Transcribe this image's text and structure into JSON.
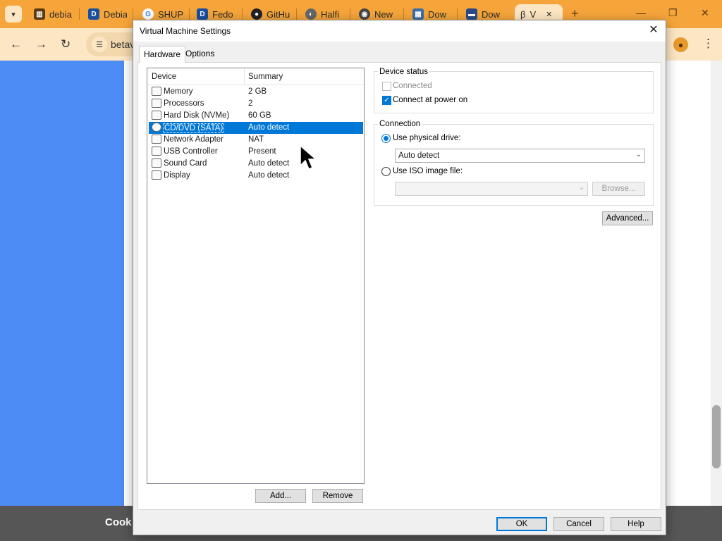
{
  "browser": {
    "tabs": [
      {
        "label": "debia",
        "icon": "library-icon",
        "color": "#5a3a10"
      },
      {
        "label": "Debia",
        "icon": "d-logo-icon",
        "color": "#1a4fa0"
      },
      {
        "label": "SHUP",
        "icon": "google-icon",
        "color": "#4285f4"
      },
      {
        "label": "Fedo",
        "icon": "d-logo-icon",
        "color": "#1a4fa0"
      },
      {
        "label": "GitHu",
        "icon": "github-icon",
        "color": "#222222"
      },
      {
        "label": "Halfi",
        "icon": "globe-icon",
        "color": "#555555"
      },
      {
        "label": "New",
        "icon": "chrome-icon",
        "color": "#444444"
      },
      {
        "label": "Dow",
        "icon": "vmware-icon",
        "color": "#3a6ea5"
      },
      {
        "label": "Dow",
        "icon": "vmware-icon",
        "color": "#2a4b8a"
      },
      {
        "label": "V",
        "icon": "beta-icon",
        "color": "#333333"
      }
    ],
    "address_text": "betav",
    "cookie_text": "Cook"
  },
  "dialog": {
    "title": "Virtual Machine Settings",
    "close_glyph": "✕",
    "tabs": [
      "Hardware",
      "Options"
    ],
    "device_list": {
      "columns": [
        "Device",
        "Summary"
      ],
      "rows": [
        {
          "device": "Memory",
          "summary": "2 GB",
          "icon": "memory-icon"
        },
        {
          "device": "Processors",
          "summary": "2",
          "icon": "processor-icon"
        },
        {
          "device": "Hard Disk (NVMe)",
          "summary": "60 GB",
          "icon": "hard-disk-icon"
        },
        {
          "device": "CD/DVD (SATA)",
          "summary": "Auto detect",
          "icon": "cd-dvd-icon",
          "selected": true
        },
        {
          "device": "Network Adapter",
          "summary": "NAT",
          "icon": "network-adapter-icon"
        },
        {
          "device": "USB Controller",
          "summary": "Present",
          "icon": "usb-controller-icon"
        },
        {
          "device": "Sound Card",
          "summary": "Auto detect",
          "icon": "sound-card-icon"
        },
        {
          "device": "Display",
          "summary": "Auto detect",
          "icon": "display-icon"
        }
      ]
    },
    "add_label": "Add...",
    "remove_label": "Remove",
    "device_status": {
      "title": "Device status",
      "connected_label": "Connected",
      "connected_checked": false,
      "connected_enabled": false,
      "power_on_label": "Connect at power on",
      "power_on_checked": true
    },
    "connection": {
      "title": "Connection",
      "physical_label": "Use physical drive:",
      "physical_selected": true,
      "physical_value": "Auto detect",
      "iso_label": "Use ISO image file:",
      "iso_selected": false,
      "iso_value": "",
      "browse_label": "Browse..."
    },
    "advanced_label": "Advanced...",
    "ok_label": "OK",
    "cancel_label": "Cancel",
    "help_label": "Help"
  }
}
